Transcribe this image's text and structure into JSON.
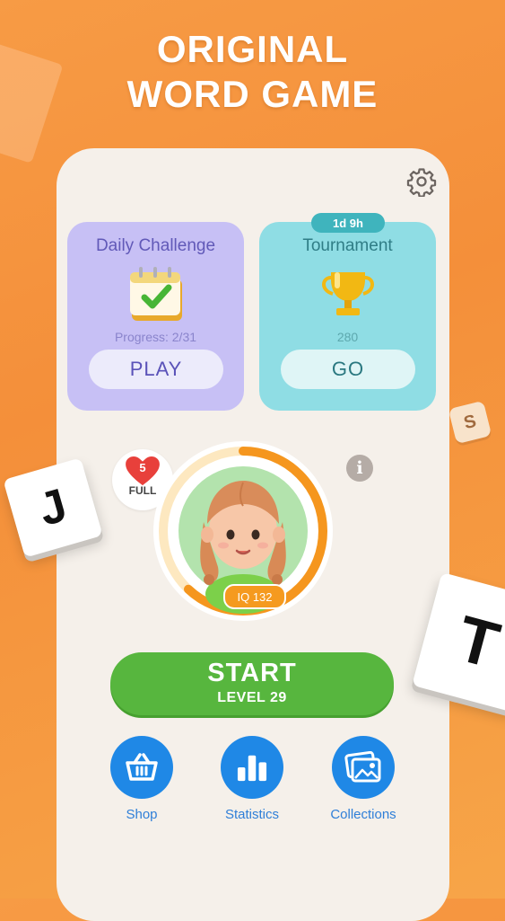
{
  "headline": {
    "line1": "ORIGINAL",
    "line2": "WORD GAME"
  },
  "settings_icon": "gear-icon",
  "daily_challenge": {
    "title": "Daily Challenge",
    "icon": "calendar-check-icon",
    "progress": "Progress: 2/31",
    "button": "PLAY"
  },
  "tournament": {
    "timer": "1d 9h",
    "title": "Tournament",
    "icon": "trophy-icon",
    "score": "280",
    "button": "GO"
  },
  "lives": {
    "count": "5",
    "label": "FULL",
    "icon": "heart-icon"
  },
  "info_icon": "info-icon",
  "player": {
    "iq": "IQ 132",
    "progress_fraction": 0.62
  },
  "start": {
    "label": "START",
    "level": "LEVEL 29"
  },
  "nav": [
    {
      "label": "Shop",
      "icon": "basket-icon"
    },
    {
      "label": "Statistics",
      "icon": "bar-chart-icon"
    },
    {
      "label": "Collections",
      "icon": "images-icon"
    }
  ],
  "tiles": {
    "j": "J",
    "t": "T",
    "s": "S"
  },
  "colors": {
    "background": "#f48f3a",
    "daily_card": "#c7c0f5",
    "tournament_card": "#8fdde4",
    "start_button": "#57b63e",
    "nav_button": "#1f88e6",
    "progress_ring": "#f5961e"
  }
}
